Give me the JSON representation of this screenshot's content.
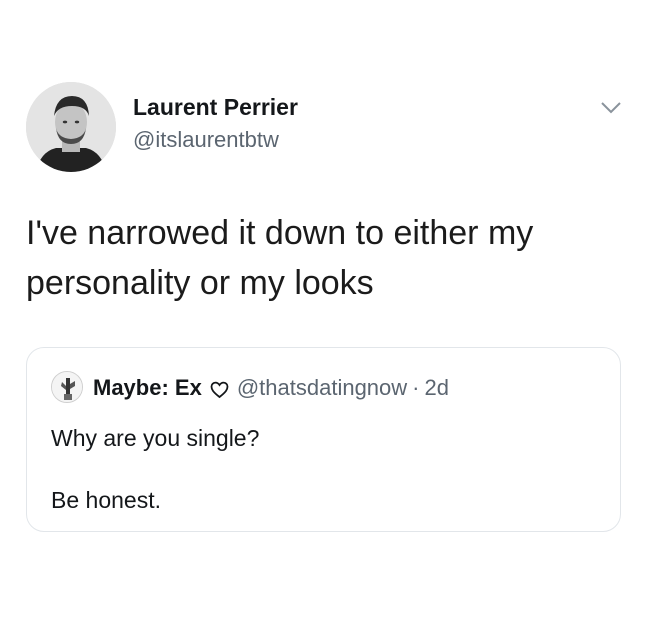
{
  "tweet": {
    "author": {
      "display_name": "Laurent Perrier",
      "handle": "@itslaurentbtw",
      "avatar_icon": "profile-photo"
    },
    "menu_icon": "chevron-down-icon",
    "text": "I've narrowed it down to either my personality or my looks"
  },
  "quoted_tweet": {
    "author": {
      "display_name": "Maybe: Ex",
      "badge_icon": "heart-outline-icon",
      "handle": "@thatsdatingnow",
      "separator": "·",
      "time": "2d",
      "avatar_icon": "profile-photo"
    },
    "line1": "Why are you single?",
    "line2": "Be honest."
  },
  "colors": {
    "text": "#14171a",
    "secondary_text": "#5b6570",
    "border": "#e2e6ea",
    "background": "#ffffff"
  }
}
